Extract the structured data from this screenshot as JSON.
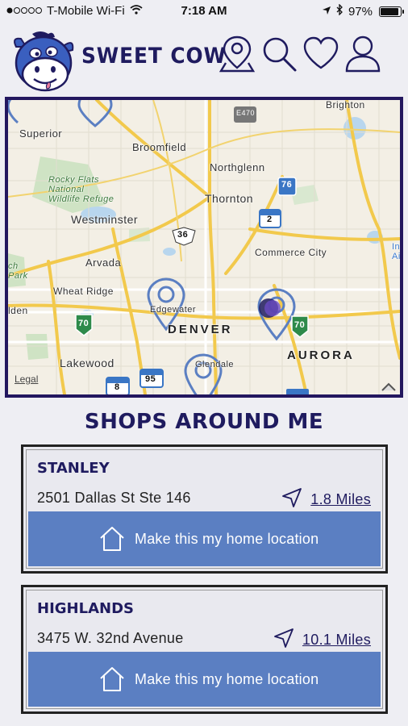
{
  "status_bar": {
    "carrier": "T-Mobile Wi-Fi",
    "time": "7:18 AM",
    "battery": "97%",
    "battery_level": 0.97
  },
  "header": {
    "brand": "SWEET COW",
    "icons": [
      "location-pin-icon",
      "search-icon",
      "heart-icon",
      "user-icon"
    ]
  },
  "map": {
    "labels": {
      "brighton": "Brighton",
      "superior": "Superior",
      "broomfield": "Broomfield",
      "northglenn": "Northglenn",
      "rocky_flats": "Rocky Flats",
      "national": "National",
      "wildlife_refuge": "Wildlife Refuge",
      "thornton": "Thornton",
      "westminster": "Westminster",
      "commerce_city": "Commerce City",
      "arvada": "Arvada",
      "wheat_ridge": "Wheat Ridge",
      "edgewater": "Edgewater",
      "denver": "DENVER",
      "aurora": "AURORA",
      "lakewood": "Lakewood",
      "glendale": "Glendale",
      "golden_partial": "lden",
      "park_partial_1": "ch",
      "park_partial_2": "Park",
      "right_partial_1": "In",
      "right_partial_2": "Ai",
      "legal": "Legal"
    },
    "shields": {
      "e470": "E470",
      "i76": "76",
      "us36": "36",
      "i25": "2",
      "i70_west": "70",
      "i70_east": "70",
      "i225": "95",
      "i8": "8"
    }
  },
  "shops_title": "SHOPS AROUND ME",
  "shops": [
    {
      "name": "STANLEY",
      "address": "2501 Dallas St Ste 146",
      "distance": "1.8 Miles",
      "home_label": "Make this my home location"
    },
    {
      "name": "HIGHLANDS",
      "address": "3475 W. 32nd Avenue",
      "distance": "10.1 Miles",
      "home_label": "Make this my home location"
    }
  ],
  "colors": {
    "brand": "#1f1b5f",
    "button": "#5b7fc2",
    "pin": "#5b7fc2",
    "map_frame": "#23175f"
  }
}
